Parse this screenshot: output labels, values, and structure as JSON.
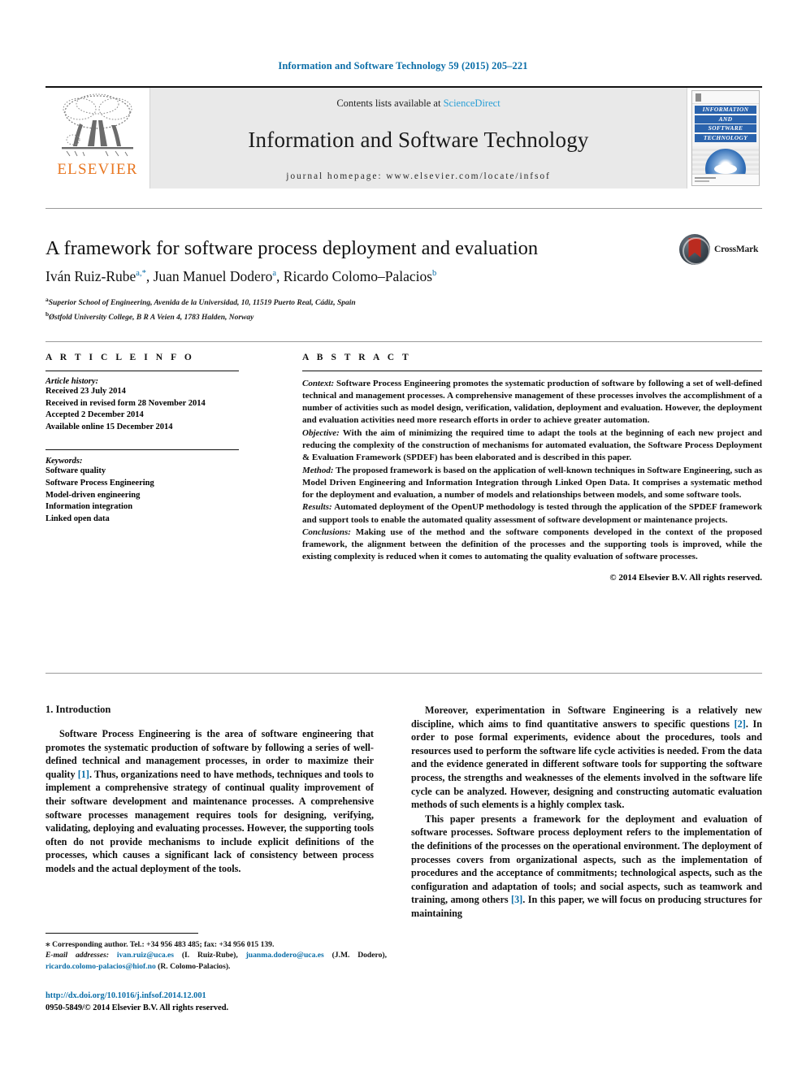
{
  "running_head": "Information and Software Technology 59 (2015) 205–221",
  "masthead": {
    "publisher_name": "ELSEVIER",
    "contents_prefix": "Contents lists available at ",
    "sciencedirect": "ScienceDirect",
    "journal_title": "Information and Software Technology",
    "homepage": "journal homepage: www.elsevier.com/locate/infsof",
    "cover_bands": [
      "INFORMATION",
      "AND",
      "SOFTWARE",
      "TECHNOLOGY"
    ]
  },
  "crossmark": {
    "label": "CrossMark"
  },
  "article": {
    "title": "A framework for software process deployment and evaluation",
    "authors_html": "Iván Ruiz-Rube, Juan Manuel Dodero, Ricardo Colomo–Palacios",
    "author_list": [
      {
        "name": "Iván Ruiz-Rube",
        "marks": "a,*"
      },
      {
        "name": "Juan Manuel Dodero",
        "marks": "a"
      },
      {
        "name": "Ricardo Colomo–Palacios",
        "marks": "b"
      }
    ],
    "affiliations": [
      {
        "mark": "a",
        "text": "Superior School of Engineering, Avenida de la Universidad, 10, 11519 Puerto Real, Cádiz, Spain"
      },
      {
        "mark": "b",
        "text": "Østfold University College, B R A Veien 4, 1783 Halden, Norway"
      }
    ]
  },
  "article_info": {
    "heading": "A R T I C L E   I N F O",
    "history_label": "Article history:",
    "history": [
      "Received 23 July 2014",
      "Received in revised form 28 November 2014",
      "Accepted 2 December 2014",
      "Available online 15 December 2014"
    ],
    "keywords_label": "Keywords:",
    "keywords": [
      "Software quality",
      "Software Process Engineering",
      "Model-driven engineering",
      "Information integration",
      "Linked open data"
    ]
  },
  "abstract": {
    "heading": "A B S T R A C T",
    "paragraphs": [
      {
        "label": "Context:",
        "text": " Software Process Engineering promotes the systematic production of software by following a set of well-defined technical and management processes. A comprehensive management of these processes involves the accomplishment of a number of activities such as model design, verification, validation, deployment and evaluation. However, the deployment and evaluation activities need more research efforts in order to achieve greater automation."
      },
      {
        "label": "Objective:",
        "text": " With the aim of minimizing the required time to adapt the tools at the beginning of each new project and reducing the complexity of the construction of mechanisms for automated evaluation, the Software Process Deployment & Evaluation Framework (SPDEF) has been elaborated and is described in this paper."
      },
      {
        "label": "Method:",
        "text": " The proposed framework is based on the application of well-known techniques in Software Engineering, such as Model Driven Engineering and Information Integration through Linked Open Data. It comprises a systematic method for the deployment and evaluation, a number of models and relationships between models, and some software tools."
      },
      {
        "label": "Results:",
        "text": " Automated deployment of the OpenUP methodology is tested through the application of the SPDEF framework and support tools to enable the automated quality assessment of software development or maintenance projects."
      },
      {
        "label": "Conclusions:",
        "text": " Making use of the method and the software components developed in the context of the proposed framework, the alignment between the definition of the processes and the supporting tools is improved, while the existing complexity is reduced when it comes to automating the quality evaluation of software processes."
      }
    ],
    "copyright": "© 2014 Elsevier B.V. All rights reserved."
  },
  "body": {
    "section_heading": "1. Introduction",
    "left_paragraphs": [
      "Software Process Engineering is the area of software engineering that promotes the systematic production of software by following a series of well-defined technical and management processes, in order to maximize their quality [1]. Thus, organizations need to have methods, techniques and tools to implement a comprehensive strategy of continual quality improvement of their software development and maintenance processes. A comprehensive software processes management requires tools for designing, verifying, validating, deploying and evaluating processes. However, the supporting tools often do not provide mechanisms to include explicit definitions of the processes, which causes a significant lack of consistency between process models and the actual deployment of the tools."
    ],
    "right_paragraphs": [
      "Moreover, experimentation in Software Engineering is a relatively new discipline, which aims to find quantitative answers to specific questions [2]. In order to pose formal experiments, evidence about the procedures, tools and resources used to perform the software life cycle activities is needed. From the data and the evidence generated in different software tools for supporting the software process, the strengths and weaknesses of the elements involved in the software life cycle can be analyzed. However, designing and constructing automatic evaluation methods of such elements is a highly complex task.",
      "This paper presents a framework for the deployment and evaluation of software processes. Software process deployment refers to the implementation of the definitions of the processes on the operational environment. The deployment of processes covers from organizational aspects, such as the implementation of procedures and the acceptance of commitments; technological aspects, such as the configuration and adaptation of tools; and social aspects, such as teamwork and training, among others [3]. In this paper, we will focus on producing structures for maintaining"
    ]
  },
  "footnote": {
    "corresponding": "Corresponding author. Tel.: +34 956 483 485; fax: +34 956 015 139.",
    "email_label": "E-mail addresses:",
    "emails": [
      {
        "address": "ivan.ruiz@uca.es",
        "owner": "(I. Ruiz-Rube)"
      },
      {
        "address": "juanma.dodero@uca.es",
        "owner": "(J.M. Dodero)"
      },
      {
        "address": "ricardo.colomo-palacios@hiof.no",
        "owner": "(R. Colomo-Palacios)"
      }
    ]
  },
  "doi_block": {
    "doi": "http://dx.doi.org/10.1016/j.infsof.2014.12.001",
    "issn_line": "0950-5849/© 2014 Elsevier B.V. All rights reserved."
  },
  "colors": {
    "link_blue": "#0b6ea8",
    "sciencedirect_blue": "#2a9fd6",
    "elsevier_orange": "#E87722",
    "band_gray": "#e9e9e9",
    "cover_blue": "#2a63ad",
    "crossmark_red": "#bb2b1f"
  }
}
